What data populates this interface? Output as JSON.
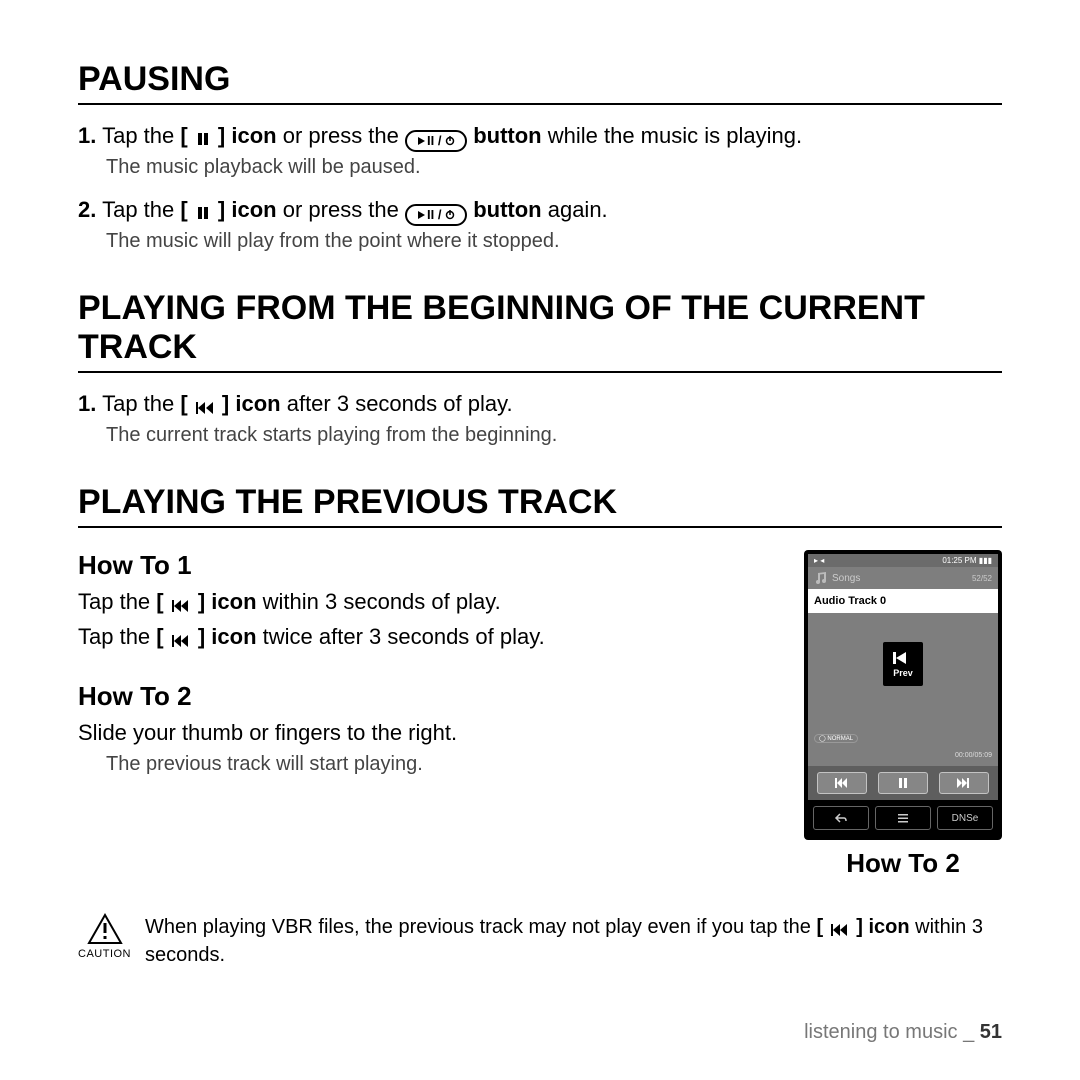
{
  "pausing": {
    "title": "PAUSING",
    "step1_a": "Tap the ",
    "step1_b": " or press the ",
    "step1_button_label": " button",
    "step1_c": " while the music is playing.",
    "step1_icon_label": "[ ▮▮ ] icon",
    "step1_sub": "The music playback will be paused.",
    "step2_a": "Tap the ",
    "step2_b": " or press the ",
    "step2_c": " again.",
    "step2_sub": "The music will play from the point where it stopped.",
    "capsule_play": "▶II",
    "capsule_power": "⏻"
  },
  "beginning": {
    "title": "PLAYING FROM THE BEGINNING OF THE CURRENT TRACK",
    "step1_a": "Tap the ",
    "step1_icon_label": "[ I◀◀ ] icon",
    "step1_b": " after 3 seconds of play.",
    "step1_sub": "The current track starts playing from the beginning."
  },
  "previous": {
    "title": "PLAYING THE PREVIOUS TRACK",
    "howto1": "How To 1",
    "howto1_l1a": "Tap the ",
    "howto1_l1b": " within 3 seconds of play.",
    "howto1_l2a": "Tap the ",
    "howto1_l2b": " twice after 3 seconds of play.",
    "icon_label": "[ I◀◀ ] icon",
    "howto2": "How To 2",
    "howto2_l1": "Slide your thumb or fingers to the right.",
    "howto2_sub": "The previous track will start playing.",
    "howto2_caption": "How To 2"
  },
  "device": {
    "time": "01:25 PM",
    "header": "Songs",
    "count": "52/52",
    "track": "Audio Track 0",
    "prev": "Prev",
    "sound": "NORMAL",
    "elapsed": "00:00/05:09",
    "dnse": "DNSe"
  },
  "caution": {
    "label": "CAUTION",
    "text_a": "When playing VBR files, the previous track may not play even if you tap the ",
    "icon_label": "[ I◀◀ ] icon",
    "text_b": " within 3 seconds."
  },
  "footer": {
    "section": "listening to music _ ",
    "page": "51"
  }
}
